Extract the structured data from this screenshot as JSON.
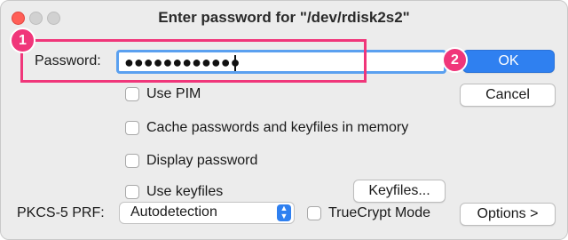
{
  "dialog": {
    "title": "Enter password for \"/dev/rdisk2s2\""
  },
  "password": {
    "label": "Password:",
    "masked_value": "●●●●●●●●●●●●"
  },
  "buttons": {
    "ok": "OK",
    "cancel": "Cancel",
    "keyfiles": "Keyfiles...",
    "options": "Options >"
  },
  "checkboxes": {
    "use_pim": "Use PIM",
    "cache": "Cache passwords and keyfiles in memory",
    "display_password": "Display password",
    "use_keyfiles": "Use keyfiles",
    "truecrypt_mode": "TrueCrypt Mode"
  },
  "prf": {
    "label": "PKCS-5 PRF:",
    "selected": "Autodetection"
  },
  "annotations": {
    "marker1": "1",
    "marker2": "2"
  },
  "colors": {
    "accent": "#2f80f0",
    "annotation": "#f0367a"
  }
}
